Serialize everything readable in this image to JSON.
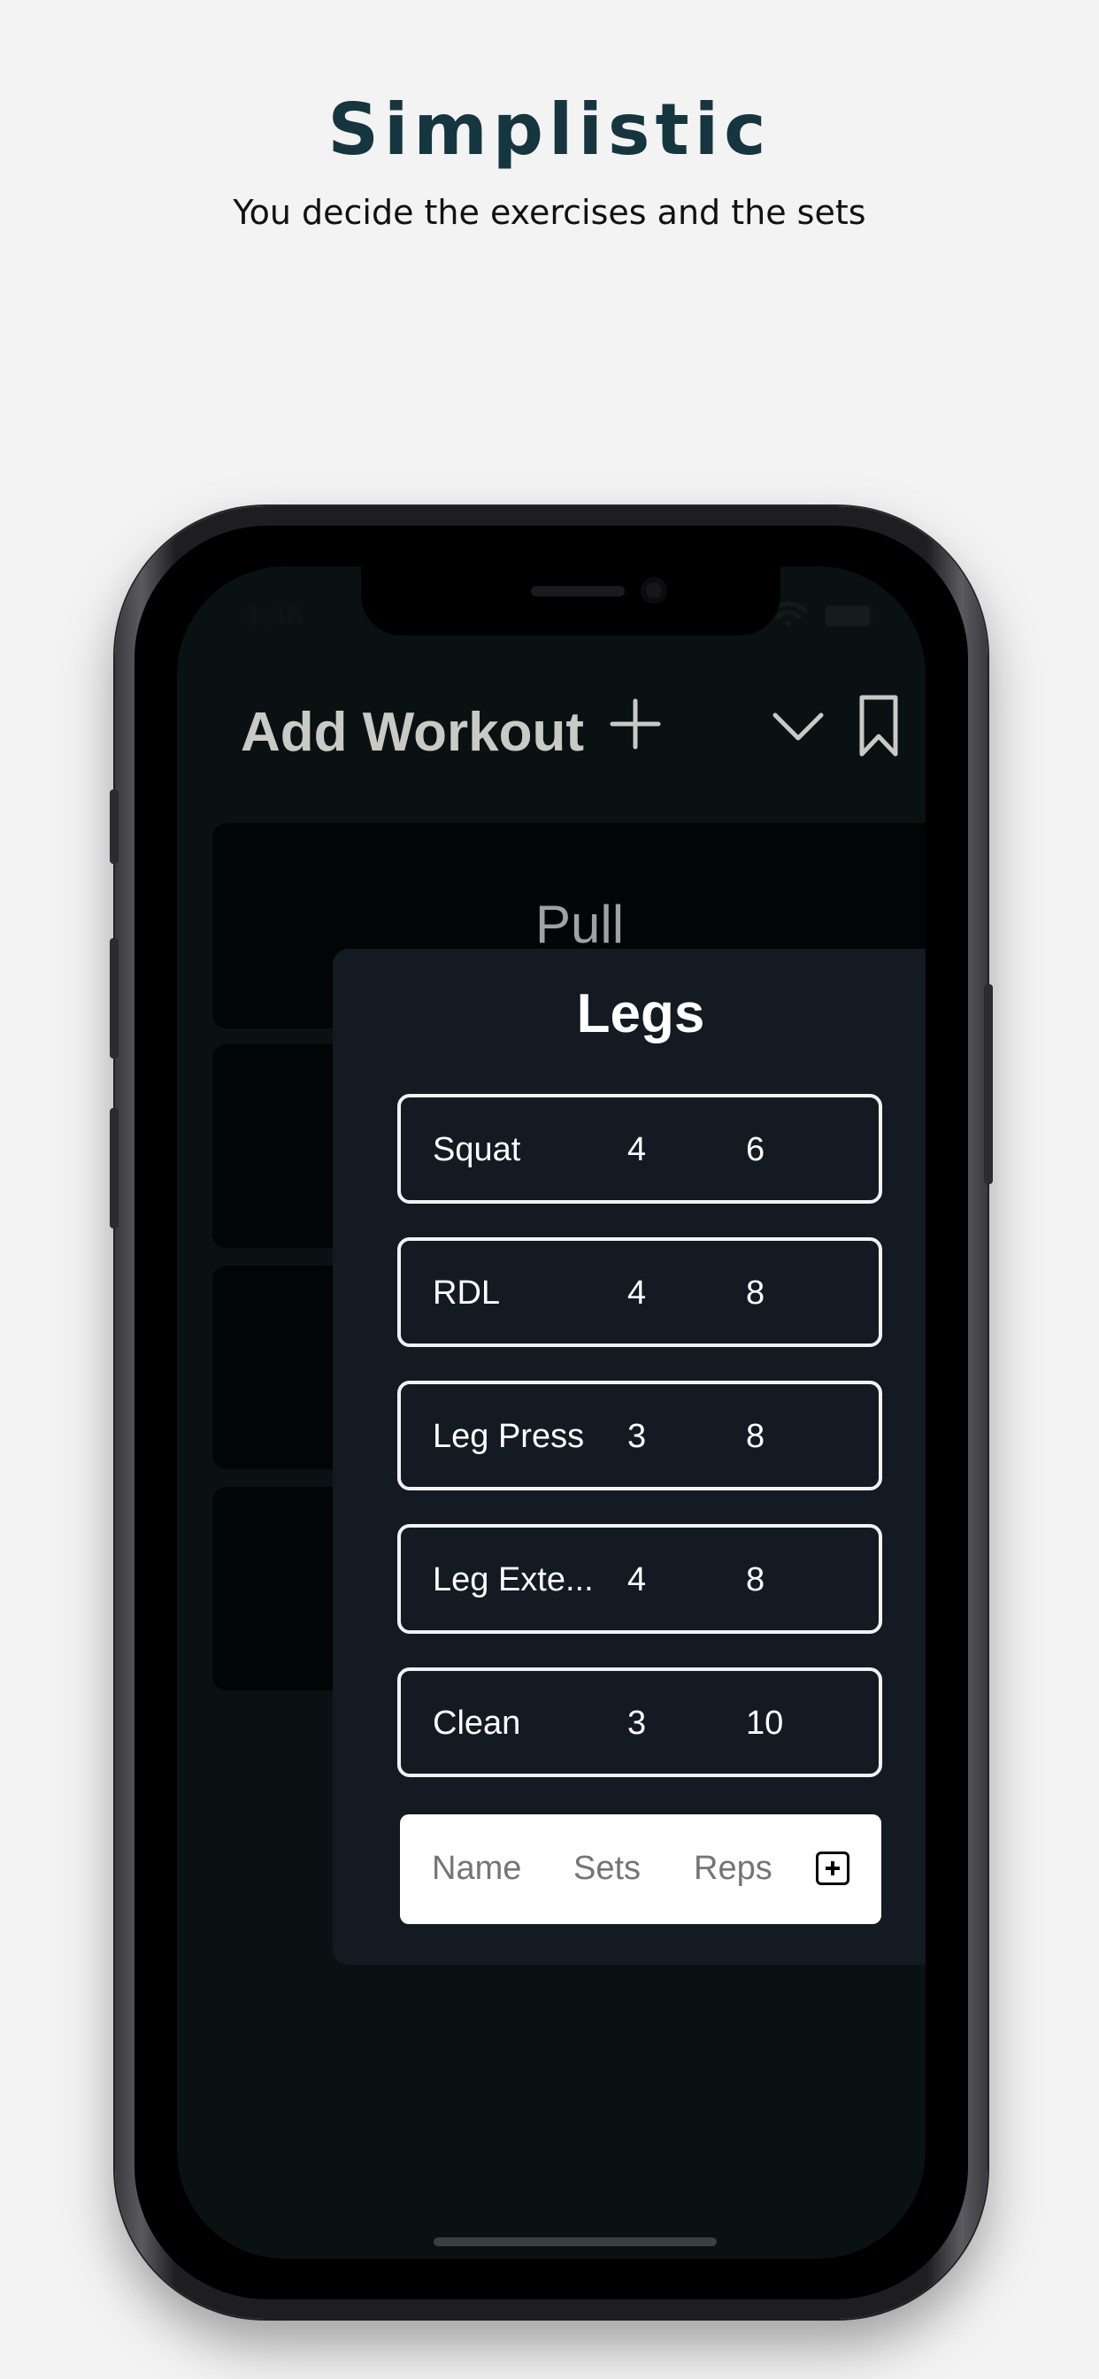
{
  "promo": {
    "headline": "Simplistic",
    "subline": "You decide the exercises and the sets"
  },
  "status_bar": {
    "time": "4:48",
    "icons": [
      "cellular-icon",
      "wifi-icon",
      "battery-icon"
    ]
  },
  "header": {
    "title": "Add Workout",
    "icons": [
      "plus-icon",
      "chevron-down-icon",
      "bookmark-icon"
    ]
  },
  "workouts": [
    {
      "title": "Pull"
    }
  ],
  "modal": {
    "title": "Legs",
    "exercises": [
      {
        "name": "Squat",
        "sets": "4",
        "reps": "6"
      },
      {
        "name": "RDL",
        "sets": "4",
        "reps": "8"
      },
      {
        "name": "Leg Press",
        "sets": "3",
        "reps": "8"
      },
      {
        "name": "Leg Exte...",
        "sets": "4",
        "reps": "8"
      },
      {
        "name": "Clean",
        "sets": "3",
        "reps": "10"
      }
    ],
    "add_form": {
      "name_placeholder": "Name",
      "sets_placeholder": "Sets",
      "reps_placeholder": "Reps",
      "add_icon": "plus-square-icon"
    }
  },
  "colors": {
    "background": "#f3f3f3",
    "headline": "#15363f",
    "screen": "#0a1113",
    "modal": "#131a21",
    "card": "#020506"
  }
}
